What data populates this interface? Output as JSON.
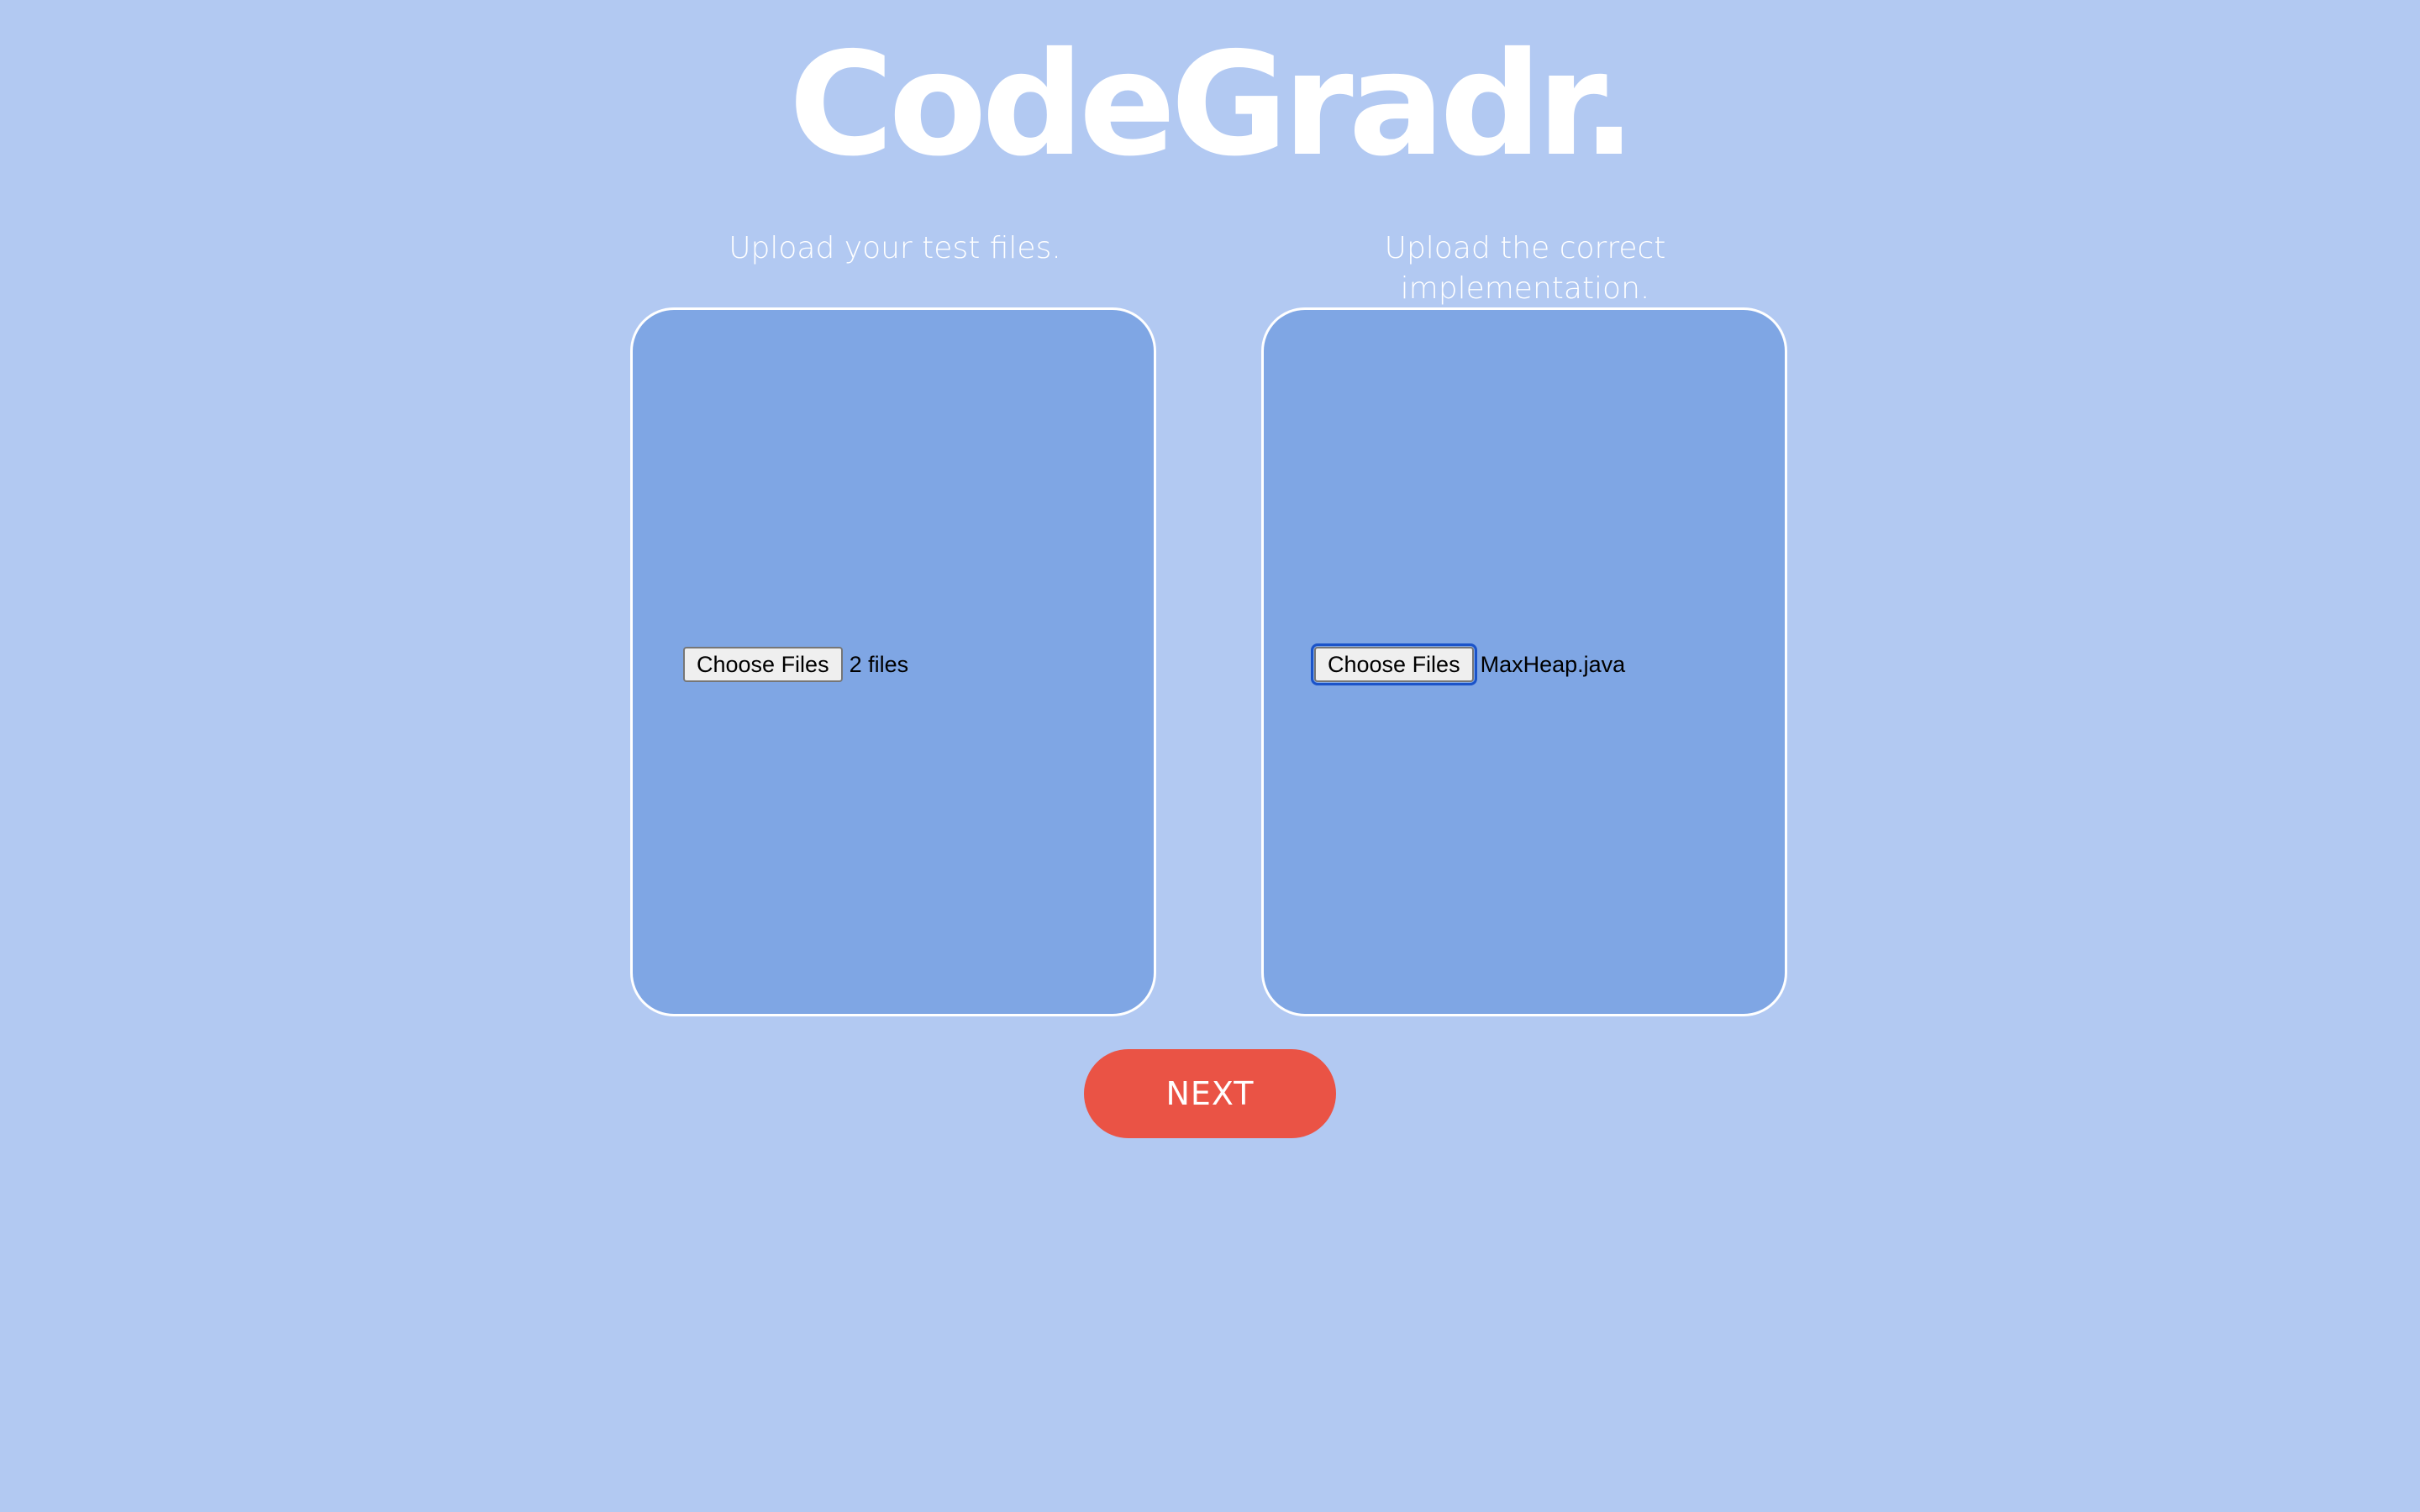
{
  "app": {
    "logo": "CodeGradr."
  },
  "tests_upload": {
    "label": "Upload your test files.",
    "button_label": "Choose Files",
    "status": "2 files"
  },
  "impl_upload": {
    "label": "Upload the correct implementation.",
    "button_label": "Choose Files",
    "status": "MaxHeap.java"
  },
  "actions": {
    "next_label": "NEXT"
  },
  "colors": {
    "background": "#b2c9f2",
    "panel": "#7fa6e4",
    "accent": "#ea5345",
    "text": "#ffffff"
  }
}
